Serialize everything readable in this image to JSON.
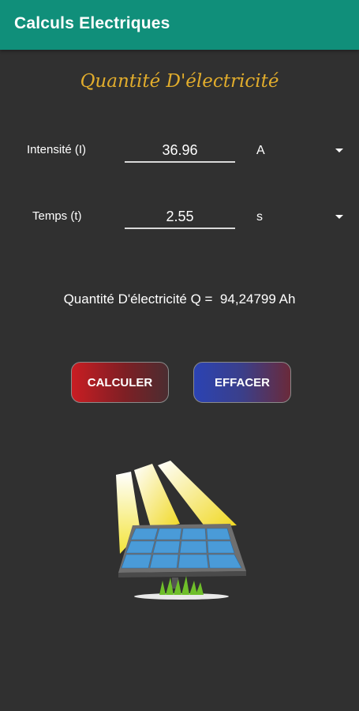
{
  "app_bar": {
    "title": "Calculs Electriques"
  },
  "page": {
    "title": "Quantité D'électricité"
  },
  "fields": [
    {
      "label": "Intensité (I)",
      "value": "36.96",
      "unit": "A"
    },
    {
      "label": "Temps (t)",
      "value": "2.55",
      "unit": "s"
    }
  ],
  "result": {
    "text": "Quantité D'électricité Q =  94,24799 Ah"
  },
  "buttons": {
    "calculate_label": "CALCULER",
    "clear_label": "EFFACER"
  },
  "colors": {
    "app_bar": "#108f7a",
    "background": "#303030",
    "title_gold": "#e2ad2c",
    "calculate_red": "#c91d23",
    "clear_blue": "#2b43b3"
  },
  "illustration": {
    "icon": "solar-panel-icon"
  }
}
